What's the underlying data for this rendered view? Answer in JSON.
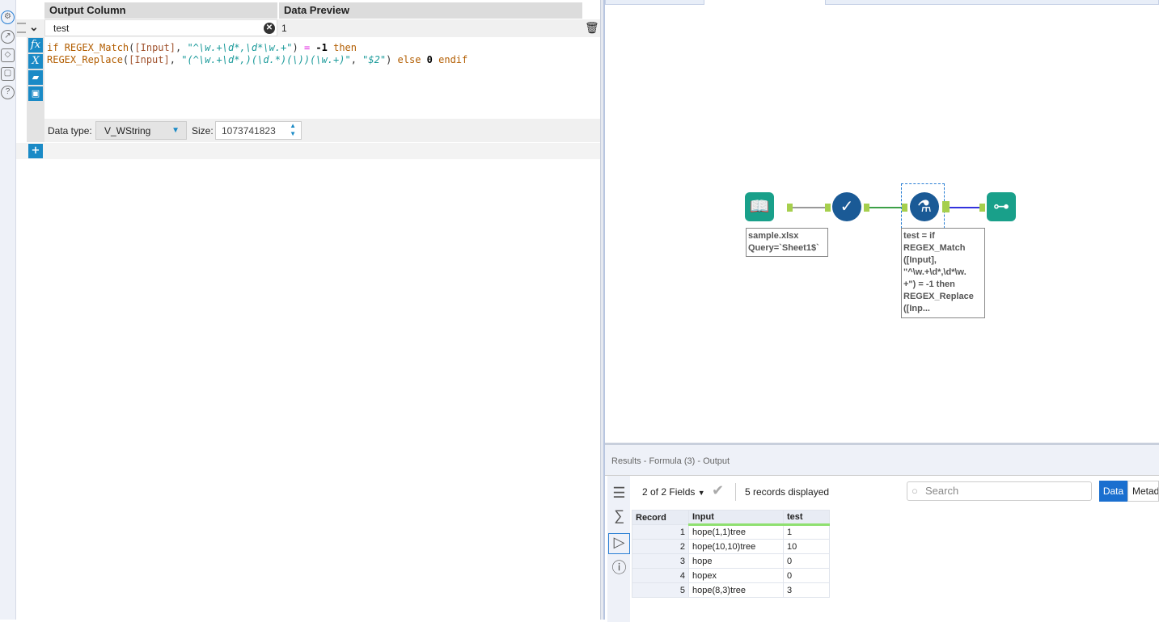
{
  "formula_panel": {
    "headers": {
      "output_column": "Output Column",
      "data_preview": "Data Preview"
    },
    "output_column_value": "test",
    "data_preview_value": "1",
    "expression": {
      "line1": [
        [
          "kw",
          "if "
        ],
        [
          "fn",
          "REGEX_Match"
        ],
        [
          "pl",
          "("
        ],
        [
          "fld",
          "[Input]"
        ],
        [
          "pl",
          ", "
        ],
        [
          "str",
          "\"^\\w.+\\d*,\\d*\\w.+\""
        ],
        [
          "pl",
          ") "
        ],
        [
          "op",
          "="
        ],
        [
          "pl",
          " "
        ],
        [
          "num",
          "-1"
        ],
        [
          "pl",
          " "
        ],
        [
          "kw",
          "then"
        ]
      ],
      "line2": [
        [
          "fn",
          "REGEX_Replace"
        ],
        [
          "pl",
          "("
        ],
        [
          "fld",
          "[Input]"
        ],
        [
          "pl",
          ", "
        ],
        [
          "str",
          "\"(^\\w.+\\d*,)(\\d.*)(\\))(\\w.+)\""
        ],
        [
          "pl",
          ", "
        ],
        [
          "str",
          "\"$2\""
        ],
        [
          "pl",
          ") "
        ],
        [
          "kw",
          "else"
        ],
        [
          "pl",
          " "
        ],
        [
          "num",
          "0"
        ],
        [
          "pl",
          " "
        ],
        [
          "kw",
          "endif"
        ]
      ]
    },
    "data_type_label": "Data type:",
    "data_type_value": "V_WString",
    "size_label": "Size:",
    "size_value": "1073741823",
    "buttons": {
      "fx": "fx",
      "x": "X",
      "add": "+"
    }
  },
  "canvas": {
    "input_annotation": [
      "sample.xlsx",
      "Query=`Sheet1$`"
    ],
    "formula_annotation": [
      "test = if",
      "REGEX_Match",
      "([Input],",
      "\"^\\w.+\\d*,\\d*\\w.",
      "+\") = -1 then",
      "REGEX_Replace",
      "([Inp..."
    ],
    "colors": {
      "input_tool": "#19a08a",
      "select_tool": "#1a5a96",
      "formula_tool": "#1a5a96",
      "browse_tool": "#19a08a",
      "anchor": "#a6cf4d"
    }
  },
  "results": {
    "title": "Results - Formula (3) - Output",
    "fields_label": "2 of 2 Fields",
    "records_label": "5 records displayed",
    "search_placeholder": "Search",
    "tabs": [
      "Data",
      "Metad"
    ],
    "columns": [
      "Record",
      "Input",
      "test"
    ],
    "rows": [
      [
        "1",
        "hope(1,1)tree",
        "1"
      ],
      [
        "2",
        "hope(10,10)tree",
        "10"
      ],
      [
        "3",
        "hope",
        "0"
      ],
      [
        "4",
        "hopex",
        "0"
      ],
      [
        "5",
        "hope(8,3)tree",
        "3"
      ]
    ]
  }
}
